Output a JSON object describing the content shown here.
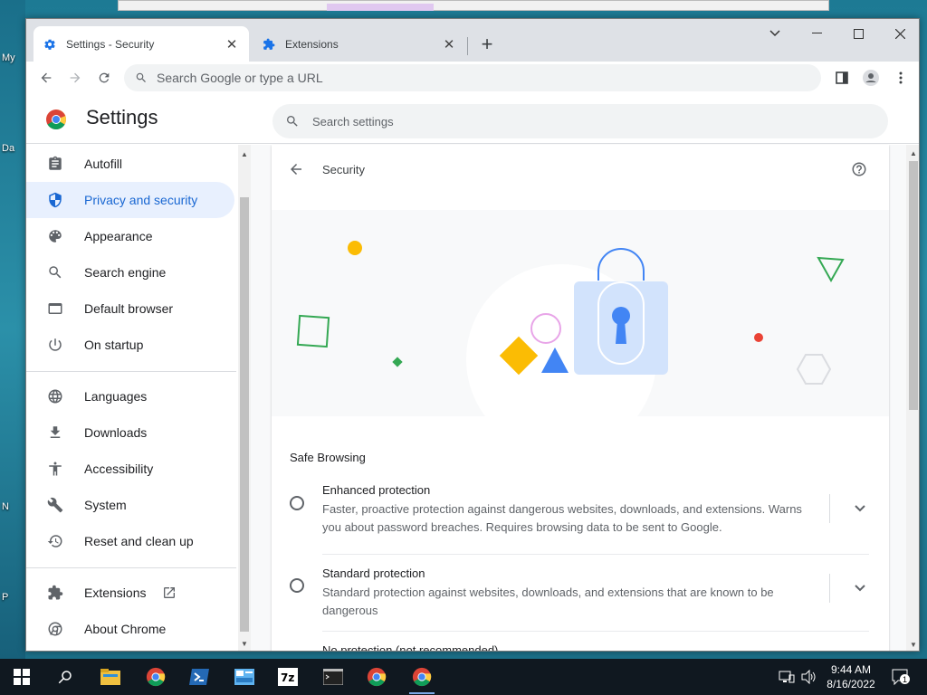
{
  "desktop": {
    "labels": [
      "My",
      "Da",
      "N",
      "P"
    ]
  },
  "browser": {
    "tabs": [
      {
        "label": "Settings - Security",
        "icon": "gear-icon",
        "active": true
      },
      {
        "label": "Extensions",
        "icon": "puzzle-icon",
        "active": false
      }
    ],
    "omnibox_placeholder": "Search Google or type a URL"
  },
  "settings": {
    "title": "Settings",
    "search_placeholder": "Search settings",
    "sidebar": [
      {
        "label": "Autofill",
        "icon": "clipboard-icon"
      },
      {
        "label": "Privacy and security",
        "icon": "shield-icon",
        "active": true
      },
      {
        "label": "Appearance",
        "icon": "palette-icon"
      },
      {
        "label": "Search engine",
        "icon": "search-icon"
      },
      {
        "label": "Default browser",
        "icon": "browser-window-icon"
      },
      {
        "label": "On startup",
        "icon": "power-icon"
      },
      {
        "label": "Languages",
        "icon": "globe-icon"
      },
      {
        "label": "Downloads",
        "icon": "download-icon"
      },
      {
        "label": "Accessibility",
        "icon": "accessibility-icon"
      },
      {
        "label": "System",
        "icon": "wrench-icon"
      },
      {
        "label": "Reset and clean up",
        "icon": "history-icon"
      },
      {
        "label": "Extensions",
        "icon": "puzzle-icon"
      },
      {
        "label": "About Chrome",
        "icon": "chrome-icon"
      }
    ],
    "page": {
      "title": "Security",
      "section": "Safe Browsing",
      "options": [
        {
          "title": "Enhanced protection",
          "description": "Faster, proactive protection against dangerous websites, downloads, and extensions. Warns you about password breaches. Requires browsing data to be sent to Google."
        },
        {
          "title": "Standard protection",
          "description": "Standard protection against websites, downloads, and extensions that are known to be dangerous"
        },
        {
          "title": "No protection (not recommended)",
          "description": ""
        }
      ]
    }
  },
  "taskbar": {
    "time": "9:44 AM",
    "date": "8/16/2022",
    "notification_count": "1"
  },
  "colors": {
    "accent": "#1967d2",
    "active_bg": "#e8f0fe",
    "taskbar": "#101820"
  }
}
